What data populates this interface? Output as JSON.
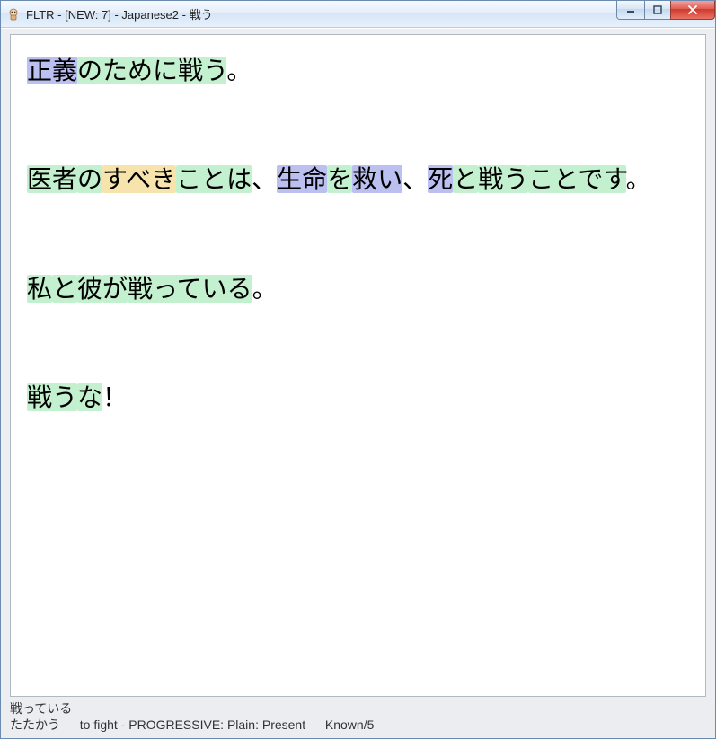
{
  "window": {
    "title": "FLTR - [NEW: 7] - Japanese2 - 戦う"
  },
  "colors": {
    "green": "#c3f0ce",
    "blue": "#bcc0f1",
    "yellow": "#f7e4ad"
  },
  "sentences": [
    {
      "tokens": [
        {
          "text": "正義",
          "color": "blue"
        },
        {
          "text": "のために",
          "color": "green"
        },
        {
          "text": "戦う",
          "color": "green"
        },
        {
          "text": "。",
          "color": "plain"
        }
      ]
    },
    {
      "tokens": [
        {
          "text": "医者",
          "color": "green"
        },
        {
          "text": "の",
          "color": "green"
        },
        {
          "text": "すべき",
          "color": "yellow"
        },
        {
          "text": "ことは",
          "color": "green"
        },
        {
          "text": "、",
          "color": "plain"
        },
        {
          "text": "生命",
          "color": "blue"
        },
        {
          "text": "を",
          "color": "green"
        },
        {
          "text": "救い",
          "color": "blue"
        },
        {
          "text": "、",
          "color": "plain"
        },
        {
          "text": "死",
          "color": "blue"
        },
        {
          "text": "と",
          "color": "green"
        },
        {
          "text": "戦う",
          "color": "green"
        },
        {
          "text": "ことです",
          "color": "green"
        },
        {
          "text": "。",
          "color": "plain"
        }
      ]
    },
    {
      "tokens": [
        {
          "text": "私",
          "color": "green"
        },
        {
          "text": "と",
          "color": "green"
        },
        {
          "text": "彼",
          "color": "green"
        },
        {
          "text": "が",
          "color": "green"
        },
        {
          "text": "戦っている",
          "color": "green"
        },
        {
          "text": "。",
          "color": "plain"
        }
      ]
    },
    {
      "tokens": [
        {
          "text": "戦う",
          "color": "green"
        },
        {
          "text": "な",
          "color": "green"
        },
        {
          "text": "！",
          "color": "plain"
        }
      ]
    }
  ],
  "status": {
    "line1": "戦っている",
    "line2": "たたかう — to fight - PROGRESSIVE: Plain: Present — Known/5"
  }
}
